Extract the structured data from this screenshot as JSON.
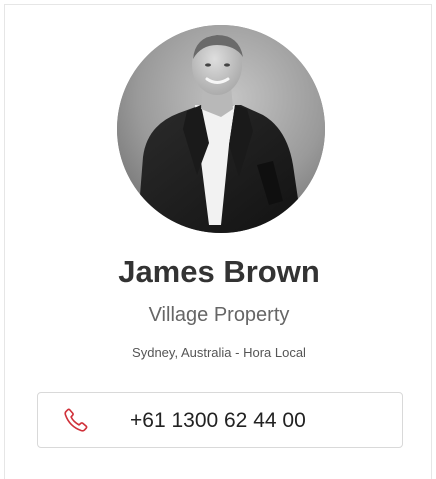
{
  "profile": {
    "name": "James Brown",
    "company": "Village Property",
    "location": "Sydney, Australia - Hora Local",
    "phone": "+61 1300 62 44 00"
  },
  "icons": {
    "avatar": "person-photo",
    "phone": "phone-icon"
  },
  "colors": {
    "accent": "#d0313a",
    "name_text": "#333333",
    "secondary_text": "#666666",
    "border": "#d9d9d9"
  }
}
